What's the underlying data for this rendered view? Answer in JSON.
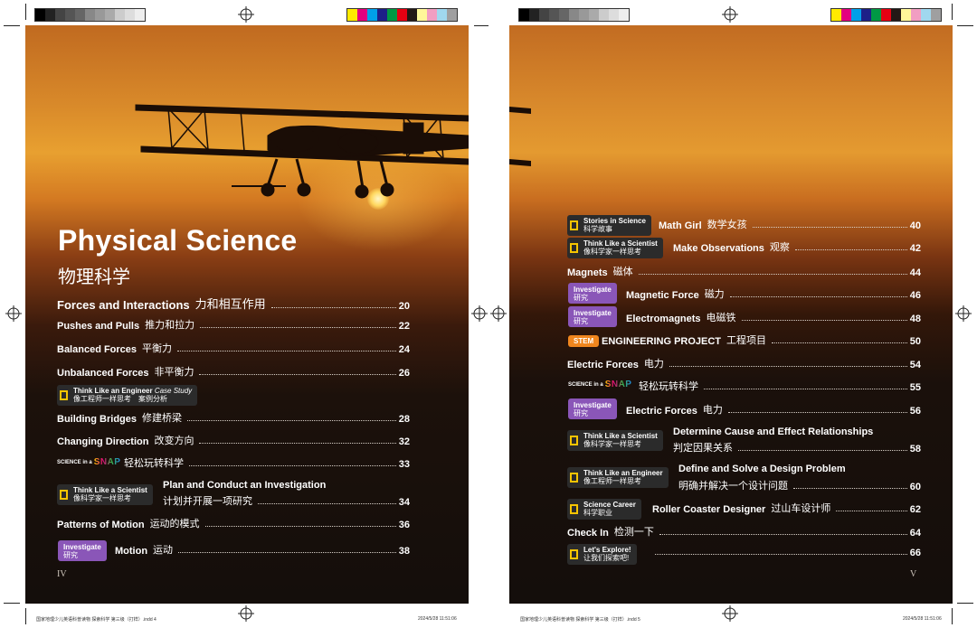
{
  "left": {
    "title": "Physical Science",
    "title_zh": "物理科学",
    "folio": "IV",
    "slug": "国家地理少儿英语科普读物 探索科学 第三级（打样）.indd 4",
    "slug_date": "2024/5/28 11:51:06",
    "items": [
      {
        "label": "Forces and Interactions",
        "zh": "力和相互作用",
        "page": "20"
      },
      {
        "label": "Pushes and Pulls",
        "zh": "推力和拉力",
        "page": "22"
      },
      {
        "label": "Balanced Forces",
        "zh": "平衡力",
        "page": "24"
      },
      {
        "label": "Unbalanced Forces",
        "zh": "非平衡力",
        "page": "26"
      },
      {
        "badge_en": "Think Like an Engineer",
        "badge_en_italic": "Case Study",
        "badge_zh": "像工程师一样思考　案例分析"
      },
      {
        "label": "Building Bridges",
        "zh": "修建桥梁",
        "page": "28"
      },
      {
        "label": "Changing Direction",
        "zh": "改变方向",
        "page": "32"
      },
      {
        "snap_prefix": "SCIENCE in a",
        "snap_word": "SNAP",
        "zh": "轻松玩转科学",
        "page": "33"
      },
      {
        "badge_en": "Think Like a Scientist",
        "badge_zh": "像科学家一样思考",
        "label": "Plan and Conduct an Investigation",
        "zh": "计划并开展一项研究",
        "page": "34"
      },
      {
        "label": "Patterns of Motion",
        "zh": "运动的模式",
        "page": "36"
      },
      {
        "inv_en": "Investigate",
        "inv_zh": "研究",
        "label": "Motion",
        "zh": "运动",
        "page": "38"
      }
    ]
  },
  "right": {
    "folio": "V",
    "slug": "国家地理少儿英语科普读物 探索科学 第三级（打样）.indd 5",
    "slug_date": "2024/5/28 11:51:06",
    "items": [
      {
        "badge_en": "Stories in Science",
        "badge_zh": "科学故事",
        "label": "Math Girl",
        "zh": "数学女孩",
        "page": "40"
      },
      {
        "badge_en": "Think Like a Scientist",
        "badge_zh": "像科学家一样思考",
        "label": "Make Observations",
        "zh": "观察",
        "page": "42"
      },
      {
        "label": "Magnets",
        "zh": "磁体",
        "page": "44"
      },
      {
        "inv_en": "Investigate",
        "inv_zh": "研究",
        "label": "Magnetic Force",
        "zh": "磁力",
        "page": "46"
      },
      {
        "inv_en": "Investigate",
        "inv_zh": "研究",
        "label": "Electromagnets",
        "zh": "电磁铁",
        "page": "48"
      },
      {
        "stem": "STEM",
        "label": "ENGINEERING PROJECT",
        "zh": "工程项目",
        "page": "50"
      },
      {
        "label": "Electric Forces",
        "zh": "电力",
        "page": "54"
      },
      {
        "snap_prefix": "SCIENCE in a",
        "snap_word": "SNAP",
        "zh": "轻松玩转科学",
        "page": "55"
      },
      {
        "inv_en": "Investigate",
        "inv_zh": "研究",
        "label": "Electric Forces",
        "zh": "电力",
        "page": "56"
      },
      {
        "badge_en": "Think Like a Scientist",
        "badge_zh": "像科学家一样思考",
        "label": "Determine Cause and Effect Relationships",
        "zh": "判定因果关系",
        "page": "58"
      },
      {
        "badge_en": "Think Like an Engineer",
        "badge_zh": "像工程师一样思考",
        "label": "Define and Solve a Design Problem",
        "zh": "明确并解决一个设计问题",
        "page": "60"
      },
      {
        "badge_en": "Science Career",
        "badge_zh": "科学职业",
        "label": "Roller Coaster Designer",
        "zh": "过山车设计师",
        "page": "62"
      },
      {
        "label": "Check In",
        "zh": "检测一下",
        "page": "64"
      },
      {
        "badge_en": "Let's Explore!",
        "badge_zh": "让我们探索吧!",
        "page": "66"
      }
    ]
  },
  "colors": {
    "investigate": "#8a56b8",
    "stem": "#f0861e",
    "badge_bg": "#2b2b2b",
    "badge_icon": "#f5c400",
    "snap_s": "#ffcc00",
    "snap_n": "#e0007a",
    "snap_a": "#3ab04a",
    "snap_p": "#1e88e5"
  }
}
